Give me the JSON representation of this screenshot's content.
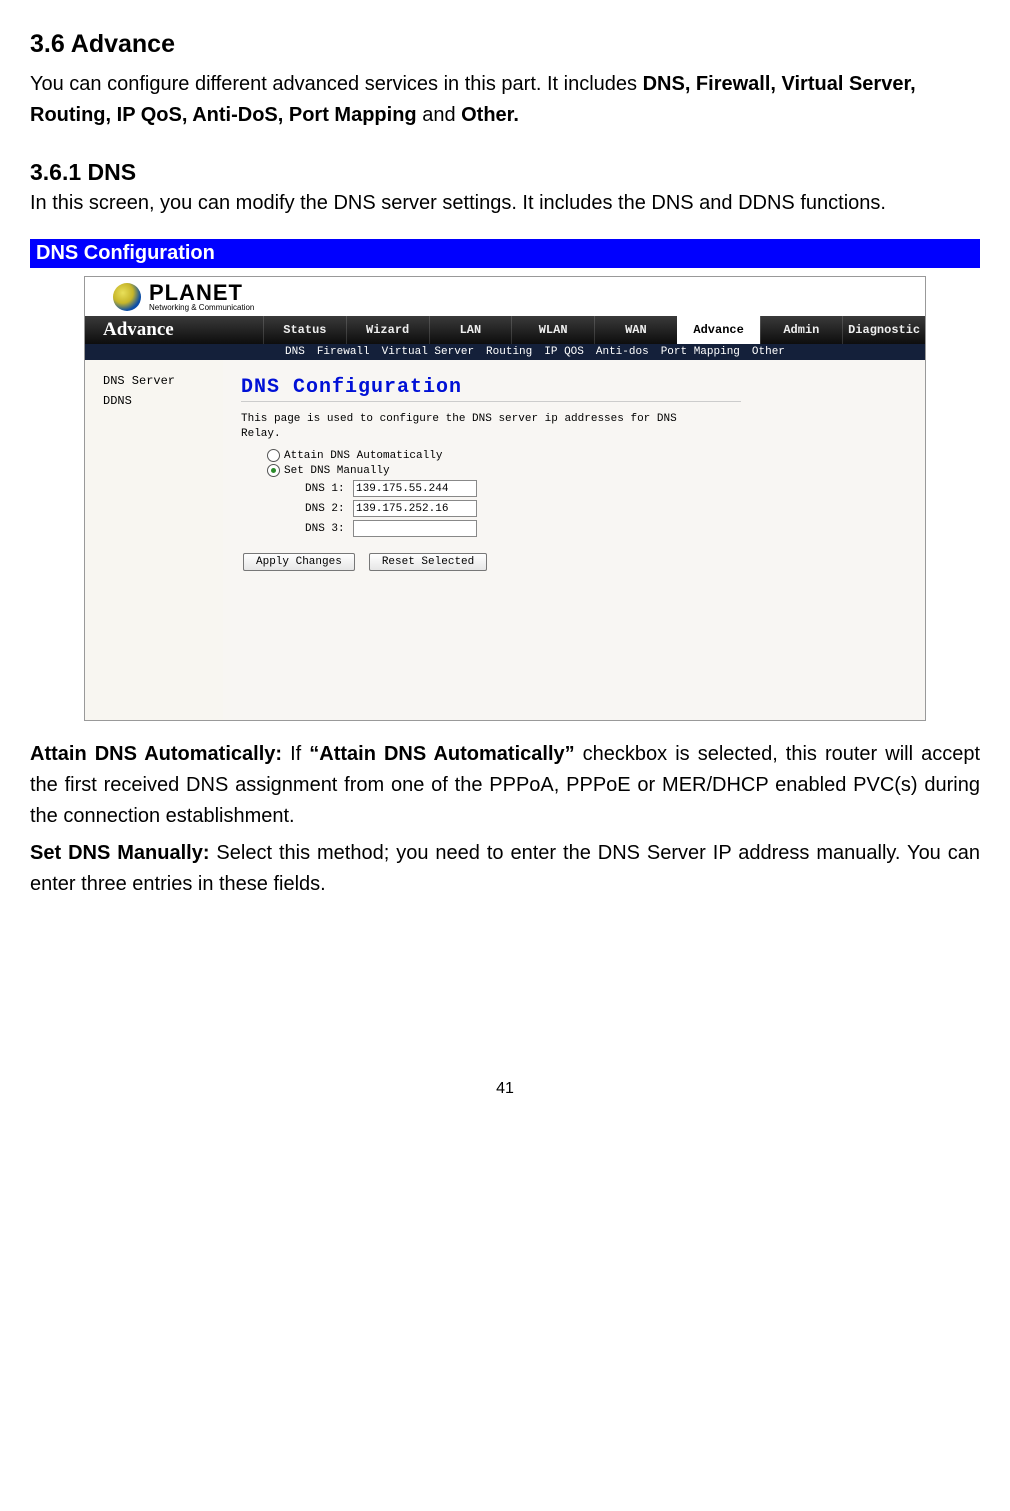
{
  "doc": {
    "section_title": "3.6 Advance",
    "intro_prefix": "You can configure different advanced services in this part. It includes ",
    "intro_bold1": "DNS, Firewall, Virtual Server, Routing, IP QoS, Anti-DoS, Port Mapping",
    "intro_mid": " and ",
    "intro_bold2": "Other.",
    "subsection_title": "3.6.1 DNS",
    "subsection_para": "In this screen, you can modify the DNS server settings. It includes the DNS and DDNS functions.",
    "bluebar": "DNS Configuration",
    "attain_label": "Attain DNS Automatically:",
    "attain_text_pre": " If ",
    "attain_quote": "“Attain DNS Automatically”",
    "attain_text_post": " checkbox is selected, this router will accept the first received DNS assignment from one of the PPPoA, PPPoE or MER/DHCP enabled PVC(s) during the connection establishment.",
    "setdns_label": "Set DNS Manually:",
    "setdns_text": " Select this method; you need to enter the DNS Server IP address manually. You can enter three entries in these fields.",
    "page_number": "41"
  },
  "shot": {
    "brand_name": "PLANET",
    "brand_sub": "Networking & Communication",
    "topnav_brand": "Advance",
    "tabs": {
      "status": "Status",
      "wizard": "Wizard",
      "lan": "LAN",
      "wlan": "WLAN",
      "wan": "WAN",
      "advance": "Advance",
      "admin": "Admin",
      "diagnostic": "Diagnostic"
    },
    "subnav": {
      "dns": "DNS",
      "firewall": "Firewall",
      "vserver": "Virtual Server",
      "routing": "Routing",
      "ipqos": "IP QOS",
      "antidos": "Anti-dos",
      "portmap": "Port Mapping",
      "other": "Other"
    },
    "sidebar": {
      "dns_server": "DNS Server",
      "ddns": "DDNS"
    },
    "panel": {
      "title": "DNS Configuration",
      "desc": "This page is used to configure the DNS server ip addresses for DNS Relay.",
      "opt_auto": "Attain DNS Automatically",
      "opt_manual": "Set DNS Manually",
      "dns1_label": "DNS 1:",
      "dns1_value": "139.175.55.244",
      "dns2_label": "DNS 2:",
      "dns2_value": "139.175.252.16",
      "dns3_label": "DNS 3:",
      "dns3_value": "",
      "btn_apply": "Apply Changes",
      "btn_reset": "Reset Selected"
    }
  }
}
